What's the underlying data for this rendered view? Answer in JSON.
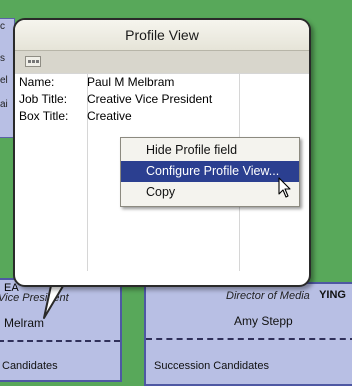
{
  "background": {
    "left_strip_lines": [
      "c",
      "s",
      "el",
      "ai"
    ],
    "left_card": {
      "role": "Vice President",
      "name": "Mel",
      "name_suffix": "ram",
      "footer": "Candidates",
      "header_fragment": "EA"
    },
    "middle_card": {
      "role": "Director of Media",
      "name": "Amy Stepp",
      "footer": "Succession Candidates",
      "tag": "YING"
    }
  },
  "popup": {
    "title": "Profile View",
    "fields": [
      {
        "label": "Name:",
        "value": "Paul M Melbram"
      },
      {
        "label": "Job Title:",
        "value": "Creative Vice President"
      },
      {
        "label": "Box Title:",
        "value": "Creative"
      }
    ]
  },
  "context_menu": {
    "items": [
      {
        "label": "Hide Profile field",
        "active": false
      },
      {
        "label": "Configure Profile View...",
        "active": true
      },
      {
        "label": "Copy",
        "active": false
      }
    ]
  },
  "colors": {
    "canvas": "#58a85a",
    "card_fill": "#b8bfe4",
    "card_border": "#4e58a3",
    "menu_highlight": "#2b3f90"
  }
}
